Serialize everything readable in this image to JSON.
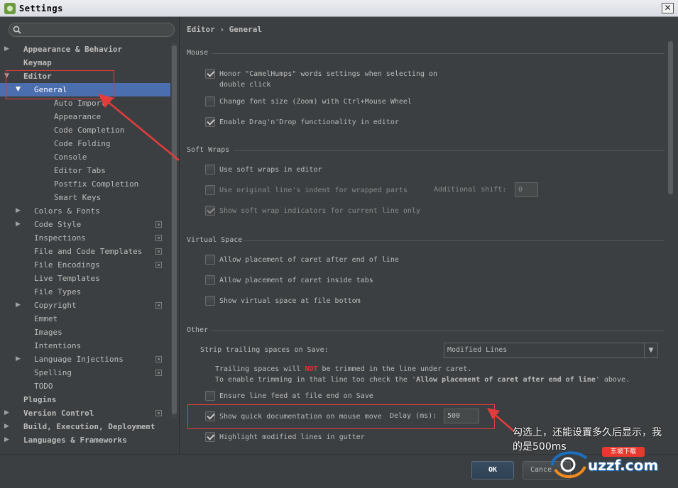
{
  "window": {
    "title": "Settings",
    "close_glyph": "✕"
  },
  "search": {
    "placeholder": "",
    "value": ""
  },
  "tree": [
    {
      "label": "Appearance & Behavior",
      "level": 0,
      "arrow": "▶",
      "bold": true,
      "selected": false,
      "proj": false
    },
    {
      "label": "Keymap",
      "level": 0,
      "arrow": "",
      "bold": true,
      "selected": false,
      "proj": false
    },
    {
      "label": "Editor",
      "level": 0,
      "arrow": "▼",
      "bold": true,
      "selected": false,
      "proj": false
    },
    {
      "label": "General",
      "level": 1,
      "arrow": "▼",
      "bold": false,
      "selected": true,
      "proj": false
    },
    {
      "label": "Auto Import",
      "level": 2,
      "arrow": "",
      "bold": false,
      "selected": false,
      "proj": false
    },
    {
      "label": "Appearance",
      "level": 2,
      "arrow": "",
      "bold": false,
      "selected": false,
      "proj": false
    },
    {
      "label": "Code Completion",
      "level": 2,
      "arrow": "",
      "bold": false,
      "selected": false,
      "proj": false
    },
    {
      "label": "Code Folding",
      "level": 2,
      "arrow": "",
      "bold": false,
      "selected": false,
      "proj": false
    },
    {
      "label": "Console",
      "level": 2,
      "arrow": "",
      "bold": false,
      "selected": false,
      "proj": false
    },
    {
      "label": "Editor Tabs",
      "level": 2,
      "arrow": "",
      "bold": false,
      "selected": false,
      "proj": false
    },
    {
      "label": "Postfix Completion",
      "level": 2,
      "arrow": "",
      "bold": false,
      "selected": false,
      "proj": false
    },
    {
      "label": "Smart Keys",
      "level": 2,
      "arrow": "",
      "bold": false,
      "selected": false,
      "proj": false
    },
    {
      "label": "Colors & Fonts",
      "level": 1,
      "arrow": "▶",
      "bold": false,
      "selected": false,
      "proj": false
    },
    {
      "label": "Code Style",
      "level": 1,
      "arrow": "▶",
      "bold": false,
      "selected": false,
      "proj": true
    },
    {
      "label": "Inspections",
      "level": 1,
      "arrow": "",
      "bold": false,
      "selected": false,
      "proj": true
    },
    {
      "label": "File and Code Templates",
      "level": 1,
      "arrow": "",
      "bold": false,
      "selected": false,
      "proj": true
    },
    {
      "label": "File Encodings",
      "level": 1,
      "arrow": "",
      "bold": false,
      "selected": false,
      "proj": true
    },
    {
      "label": "Live Templates",
      "level": 1,
      "arrow": "",
      "bold": false,
      "selected": false,
      "proj": false
    },
    {
      "label": "File Types",
      "level": 1,
      "arrow": "",
      "bold": false,
      "selected": false,
      "proj": false
    },
    {
      "label": "Copyright",
      "level": 1,
      "arrow": "▶",
      "bold": false,
      "selected": false,
      "proj": true
    },
    {
      "label": "Emmet",
      "level": 1,
      "arrow": "",
      "bold": false,
      "selected": false,
      "proj": false
    },
    {
      "label": "Images",
      "level": 1,
      "arrow": "",
      "bold": false,
      "selected": false,
      "proj": false
    },
    {
      "label": "Intentions",
      "level": 1,
      "arrow": "",
      "bold": false,
      "selected": false,
      "proj": false
    },
    {
      "label": "Language Injections",
      "level": 1,
      "arrow": "▶",
      "bold": false,
      "selected": false,
      "proj": true
    },
    {
      "label": "Spelling",
      "level": 1,
      "arrow": "",
      "bold": false,
      "selected": false,
      "proj": true
    },
    {
      "label": "TODO",
      "level": 1,
      "arrow": "",
      "bold": false,
      "selected": false,
      "proj": false
    },
    {
      "label": "Plugins",
      "level": 0,
      "arrow": "",
      "bold": true,
      "selected": false,
      "proj": false
    },
    {
      "label": "Version Control",
      "level": 0,
      "arrow": "▶",
      "bold": true,
      "selected": false,
      "proj": true
    },
    {
      "label": "Build, Execution, Deployment",
      "level": 0,
      "arrow": "▶",
      "bold": true,
      "selected": false,
      "proj": false
    },
    {
      "label": "Languages & Frameworks",
      "level": 0,
      "arrow": "▶",
      "bold": true,
      "selected": false,
      "proj": false
    }
  ],
  "main": {
    "breadcrumb": "Editor › General",
    "sections": {
      "mouse": "Mouse",
      "soft_wraps": "Soft Wraps",
      "virtual_space": "Virtual Space",
      "other": "Other"
    },
    "options": {
      "camel_humps_1": "Honor \"CamelHumps\" words settings when selecting on",
      "camel_humps_2": "double click",
      "zoom": "Change font size (Zoom) with Ctrl+Mouse Wheel",
      "drag_drop": "Enable Drag'n'Drop functionality in editor",
      "soft_wraps": "Use soft wraps in editor",
      "original_indent": "Use original line's indent for wrapped parts",
      "additional_shift_label": "Additional shift:",
      "additional_shift_value": "0",
      "wrap_indicators": "Show soft wrap indicators for current line only",
      "caret_after_eol": "Allow placement of caret after end of line",
      "caret_inside_tabs": "Allow placement of caret inside tabs",
      "virtual_space_bottom": "Show virtual space at file bottom",
      "strip_label": "Strip trailing spaces on Save:",
      "strip_value": "Modified Lines",
      "note1_pre": "Trailing spaces will ",
      "note1_not": "NOT",
      "note1_post": " be trimmed in the line under caret.",
      "note2_pre": "To enable trimming in that line too check the '",
      "note2_bold": "Allow placement of caret after end of line",
      "note2_post": "' above.",
      "line_feed": "Ensure line feed at file end on Save",
      "quick_doc": "Show quick documentation on mouse move",
      "delay_label": "Delay (ms):",
      "delay_value": "500",
      "highlight_modified": "Highlight modified lines in gutter"
    },
    "checked": {
      "camel_humps": true,
      "zoom": false,
      "drag_drop": true,
      "soft_wraps": false,
      "original_indent": false,
      "wrap_indicators": true,
      "caret_after_eol": false,
      "caret_inside_tabs": false,
      "virtual_space_bottom": false,
      "line_feed": false,
      "quick_doc": true,
      "highlight_modified": true
    }
  },
  "buttons": {
    "ok": "OK",
    "cancel": "Cance"
  },
  "annotation": {
    "text": "勾选上，还能设置多久后显示，我的是500ms"
  },
  "watermark": {
    "badge": "东坡下载",
    "text": "uzzf.com"
  },
  "colors": {
    "background": "#3c3f41",
    "selection": "#4b6eaf",
    "annotation_red": "#e43c3c",
    "text": "#bbbbbb"
  }
}
